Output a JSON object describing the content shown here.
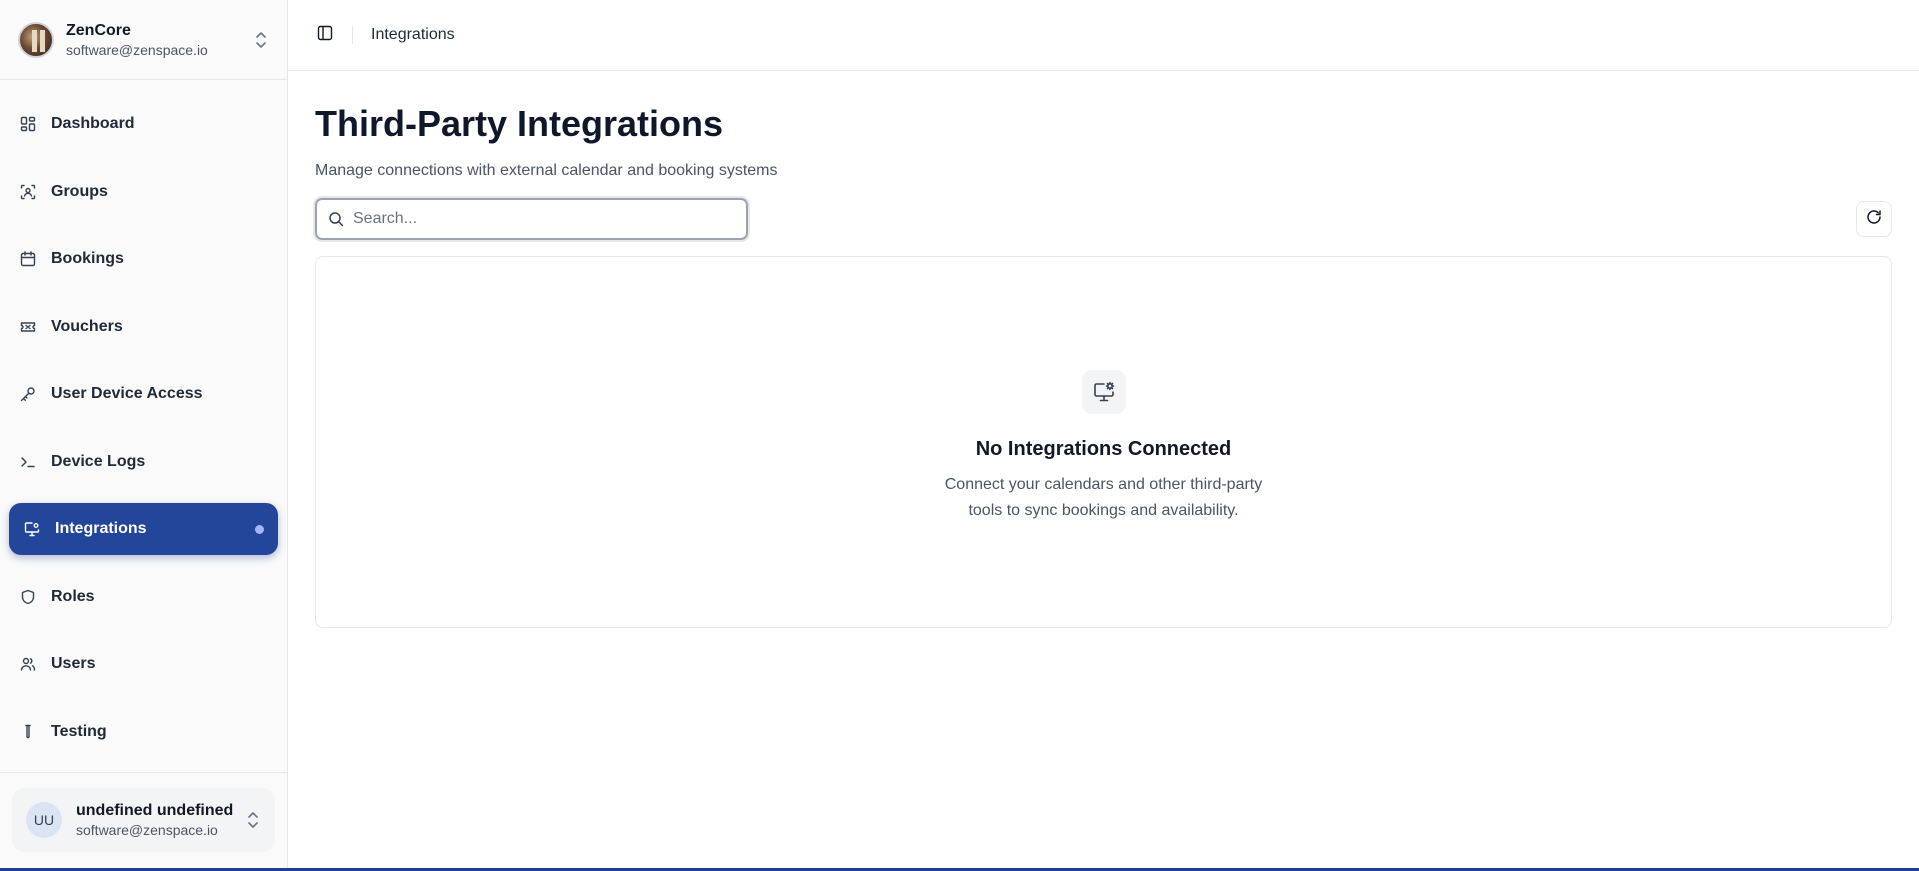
{
  "org": {
    "name": "ZenCore",
    "email": "software@zenspace.io"
  },
  "sidebar": {
    "items": [
      {
        "label": "Dashboard",
        "icon": "dashboard-icon"
      },
      {
        "label": "Groups",
        "icon": "groups-icon"
      },
      {
        "label": "Bookings",
        "icon": "calendar-icon"
      },
      {
        "label": "Vouchers",
        "icon": "ticket-icon"
      },
      {
        "label": "User Device Access",
        "icon": "key-icon"
      },
      {
        "label": "Device Logs",
        "icon": "terminal-icon"
      },
      {
        "label": "Integrations",
        "icon": "monitor-cog-icon",
        "active": true
      },
      {
        "label": "Roles",
        "icon": "shield-icon"
      },
      {
        "label": "Users",
        "icon": "users-icon"
      },
      {
        "label": "Testing",
        "icon": "test-tube-icon"
      }
    ]
  },
  "user": {
    "initials": "UU",
    "name": "undefined undefined",
    "email": "software@zenspace.io"
  },
  "header": {
    "breadcrumb": "Integrations"
  },
  "page": {
    "title": "Third-Party Integrations",
    "subtitle": "Manage connections with external calendar and booking systems"
  },
  "search": {
    "placeholder": "Search...",
    "value": ""
  },
  "empty_state": {
    "title": "No Integrations Connected",
    "description": "Connect your calendars and other third-party tools to sync bookings and availability."
  },
  "colors": {
    "accent": "#24469a",
    "border": "#e5e7eb"
  }
}
